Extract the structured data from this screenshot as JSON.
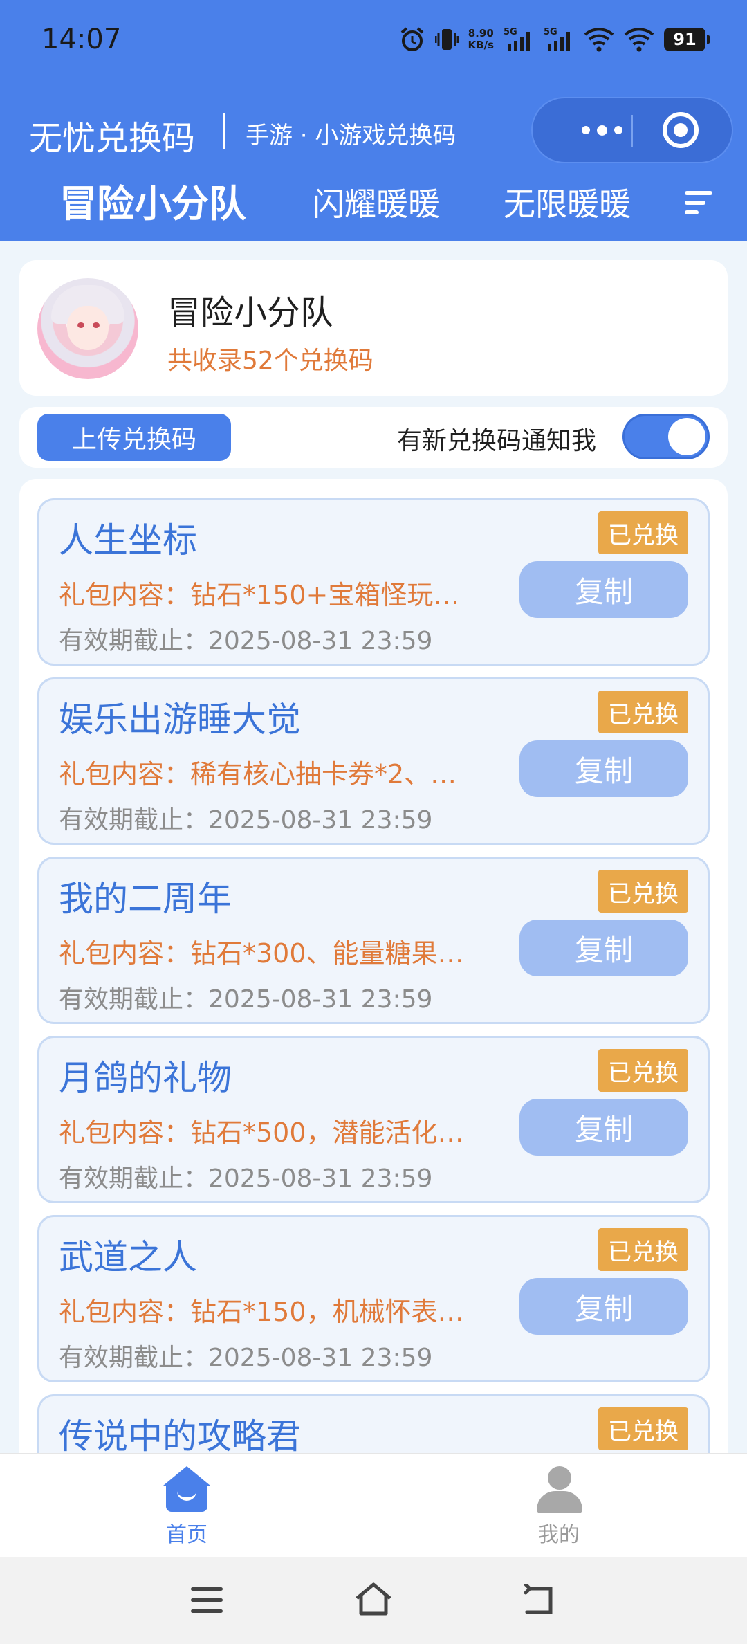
{
  "status_bar": {
    "time": "14:07",
    "net_speed_value": "8.90",
    "net_speed_unit": "KB/s",
    "sim1": "5G",
    "sim2": "5G",
    "battery": "91"
  },
  "header": {
    "app_title": "无忧兑换码",
    "subtitle": "手游 · 小游戏兑换码"
  },
  "tabs": [
    {
      "label": "冒险小分队",
      "active": true
    },
    {
      "label": "闪耀暖暖",
      "active": false
    },
    {
      "label": "无限暖暖",
      "active": false
    }
  ],
  "game": {
    "name": "冒险小分队",
    "count_text": "共收录52个兑换码"
  },
  "actions": {
    "upload_label": "上传兑换码",
    "notify_label": "有新兑换码通知我",
    "notify_enabled": true
  },
  "codes": [
    {
      "title": "人生坐标",
      "badge": "已兑换",
      "gift": "礼包内容：钻石*150+宝箱怪玩…",
      "expiry": "有效期截止：2025-08-31 23:59",
      "copy": "复制"
    },
    {
      "title": "娱乐出游睡大觉",
      "badge": "已兑换",
      "gift": "礼包内容：稀有核心抽卡券*2、…",
      "expiry": "有效期截止：2025-08-31 23:59",
      "copy": "复制"
    },
    {
      "title": "我的二周年",
      "badge": "已兑换",
      "gift": "礼包内容：钻石*300、能量糖果…",
      "expiry": "有效期截止：2025-08-31 23:59",
      "copy": "复制"
    },
    {
      "title": "月鸽的礼物",
      "badge": "已兑换",
      "gift": "礼包内容：钻石*500，潜能活化…",
      "expiry": "有效期截止：2025-08-31 23:59",
      "copy": "复制"
    },
    {
      "title": "武道之人",
      "badge": "已兑换",
      "gift": "礼包内容：钻石*150，机械怀表…",
      "expiry": "有效期截止：2025-08-31 23:59",
      "copy": "复制"
    },
    {
      "title": "传说中的攻略君",
      "badge": "已兑换",
      "gift": "",
      "expiry": "",
      "copy": ""
    }
  ],
  "tabbar": {
    "home_label": "首页",
    "mine_label": "我的"
  },
  "colors": {
    "primary": "#4a80ea",
    "accent_orange": "#e07a3a",
    "badge": "#e9a84a",
    "copy_button": "#a0bdf2"
  }
}
